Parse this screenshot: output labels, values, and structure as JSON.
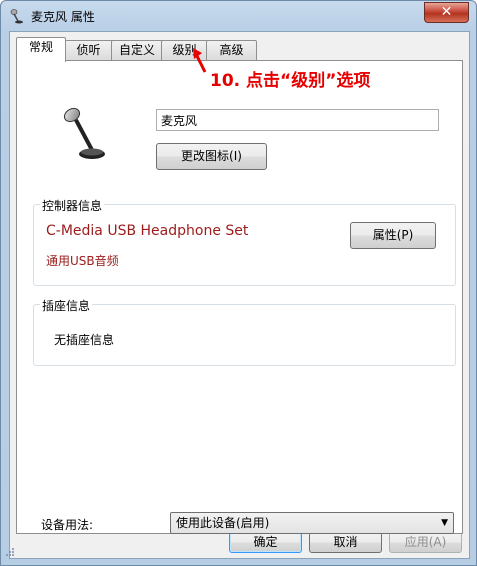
{
  "window": {
    "title": "麦克风 属性",
    "close_glyph": "✕"
  },
  "tabs": [
    "常规",
    "侦听",
    "自定义",
    "级别",
    "高级"
  ],
  "annotation": "10. 点击“级别”选项",
  "device_name": "麦克风",
  "change_icon_button": "更改图标(I)",
  "controller": {
    "label": "控制器信息",
    "name": "C-Media USB Headphone Set",
    "type": "通用USB音频",
    "properties_button": "属性(P)"
  },
  "jack": {
    "label": "插座信息",
    "text": "无插座信息"
  },
  "usage": {
    "label": "设备用法:",
    "value": "使用此设备(启用)"
  },
  "footer": {
    "ok": "确定",
    "cancel": "取消",
    "apply": "应用(A)"
  },
  "colors": {
    "annotation": "#e60000",
    "controller_text": "#9c1b1b",
    "ok_focus": "#3399ff"
  }
}
